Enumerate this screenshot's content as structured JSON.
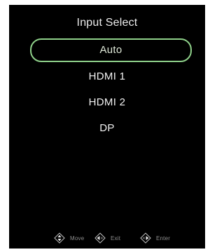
{
  "osd": {
    "title": "Input Select",
    "items": [
      {
        "label": "Auto",
        "selected": true
      },
      {
        "label": "HDMI 1",
        "selected": false
      },
      {
        "label": "HDMI 2",
        "selected": false
      },
      {
        "label": "DP",
        "selected": false
      }
    ],
    "footer": {
      "move": {
        "label": "Move",
        "icon": "dpad-up-down-icon"
      },
      "exit": {
        "label": "Exit",
        "icon": "dpad-left-icon"
      },
      "enter": {
        "label": "Enter",
        "icon": "dpad-right-icon"
      }
    }
  },
  "colors": {
    "background": "#000000",
    "text": "#f2f2f2",
    "selection_outline": "#8fd18a",
    "hint_text": "#8f8f8f"
  }
}
